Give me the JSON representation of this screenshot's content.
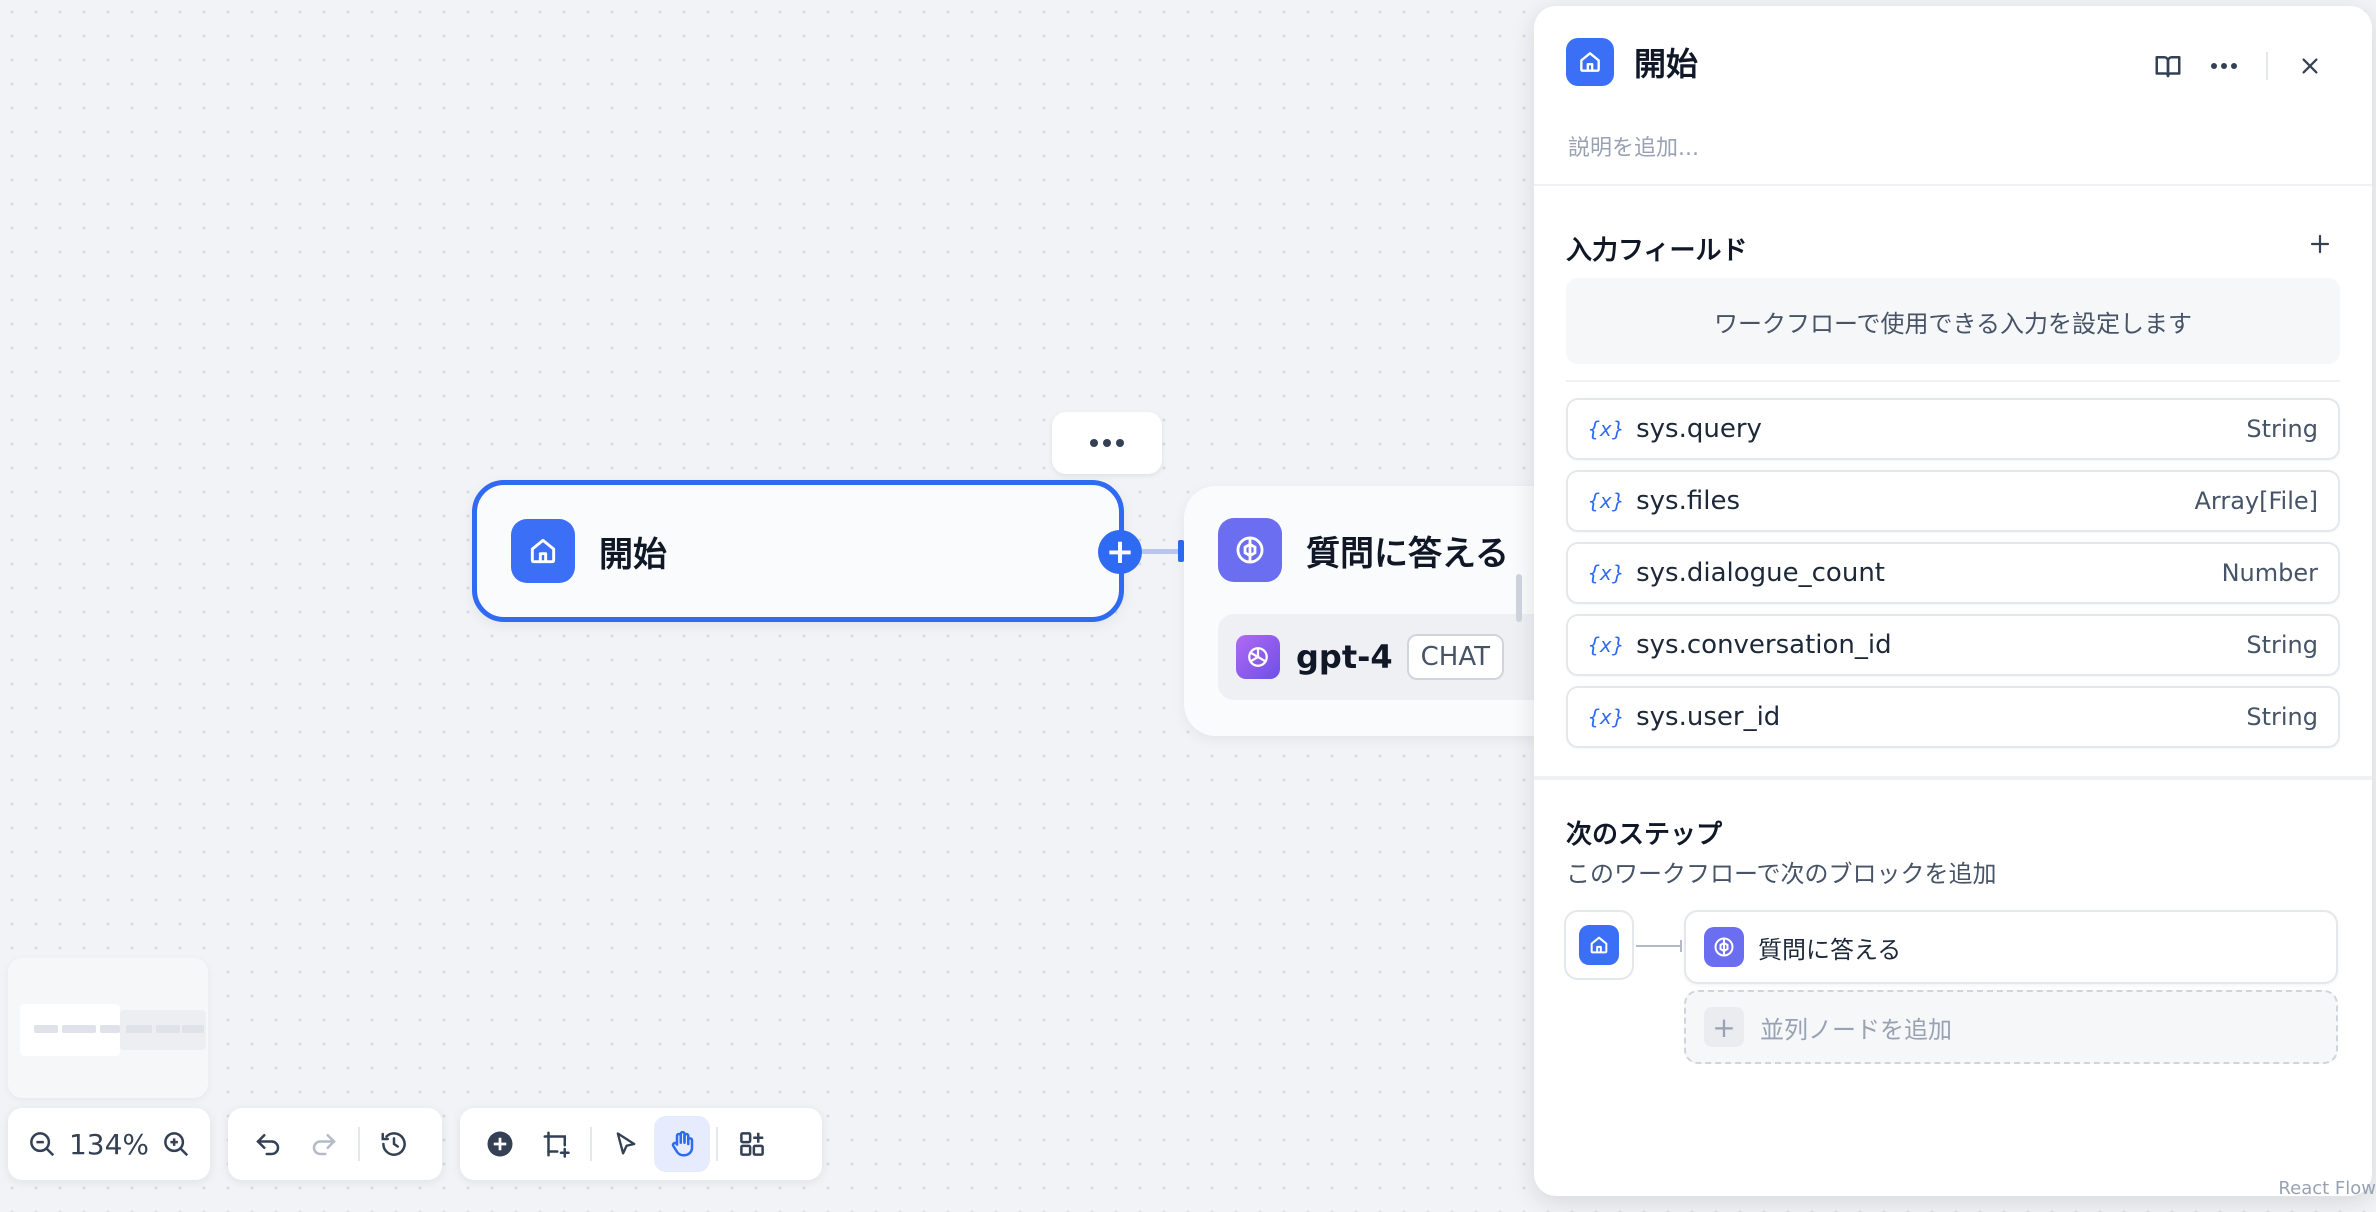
{
  "canvas": {
    "start_node": {
      "title": "開始",
      "icon": "home-icon"
    },
    "llm_node": {
      "title": "質問に答える",
      "icon": "brain-icon",
      "model": {
        "name": "gpt-4",
        "tag": "CHAT",
        "icon": "openai-icon"
      }
    }
  },
  "controls": {
    "zoom_level": "134%",
    "icons": [
      "zoom-out-icon",
      "zoom-in-icon",
      "undo-icon",
      "redo-icon",
      "history-icon",
      "add-node-icon",
      "add-note-icon",
      "pointer-icon",
      "hand-icon",
      "organize-icon"
    ],
    "active_tool": "hand"
  },
  "panel": {
    "title": "開始",
    "description_placeholder": "説明を追加...",
    "inputs": {
      "title": "入力フィールド",
      "hint": "ワークフローで使用できる入力を設定します",
      "variables": [
        {
          "icon": "{x}",
          "name": "sys.query",
          "type": "String"
        },
        {
          "icon": "{x}",
          "name": "sys.files",
          "type": "Array[File]"
        },
        {
          "icon": "{x}",
          "name": "sys.dialogue_count",
          "type": "Number"
        },
        {
          "icon": "{x}",
          "name": "sys.conversation_id",
          "type": "String"
        },
        {
          "icon": "{x}",
          "name": "sys.user_id",
          "type": "String"
        }
      ]
    },
    "next_step": {
      "title": "次のステップ",
      "subtitle": "このワークフローで次のブロックを追加",
      "target": "質問に答える",
      "add_parallel": "並列ノードを追加"
    }
  },
  "colors": {
    "accent": "#2f6af3",
    "llm": "#6b6ef0",
    "background": "#f2f3f6"
  },
  "attribution": "React Flow"
}
